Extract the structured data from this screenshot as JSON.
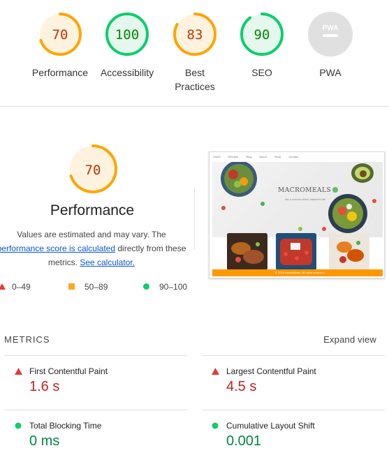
{
  "gauges": [
    {
      "label": "Performance",
      "score": "70",
      "value": 0.7,
      "status": "average"
    },
    {
      "label": "Accessibility",
      "score": "100",
      "value": 1.0,
      "status": "pass"
    },
    {
      "label_line1": "Best",
      "label_line2": "Practices",
      "score": "83",
      "value": 0.83,
      "status": "average"
    },
    {
      "label": "SEO",
      "score": "90",
      "value": 0.9,
      "status": "pass"
    },
    {
      "label": "PWA",
      "badge": "PWA",
      "status": "na"
    }
  ],
  "performance": {
    "score": "70",
    "value": 0.7,
    "title": "Performance",
    "note_before": "Values are estimated and may vary. The",
    "note_link": "performance score is calculated",
    "note_middle": "directly from these metrics.",
    "calc_link": "See calculator."
  },
  "legend": {
    "fail": "0–49",
    "average": "50–89",
    "pass": "90–100"
  },
  "thumbnail": {
    "nav": [
      "Home",
      "Recipes",
      "Blog",
      "About",
      "Shop",
      "Contact"
    ],
    "title": "MACROMEALS",
    "subtitle": "eat a macronutrient balanced life",
    "footer": "© 2023 MacroMeals. All rights reserved."
  },
  "metrics": {
    "heading": "METRICS",
    "expand_label": "Expand view",
    "items": [
      {
        "name": "First Contentful Paint",
        "value": "1.6 s",
        "status": "fail"
      },
      {
        "name": "Largest Contentful Paint",
        "value": "4.5 s",
        "status": "fail"
      },
      {
        "name": "Total Blocking Time",
        "value": "0 ms",
        "status": "pass"
      },
      {
        "name": "Cumulative Layout Shift",
        "value": "0.001",
        "status": "pass"
      }
    ]
  },
  "colors": {
    "average_stroke": "#ffa400",
    "average_fill": "#fff3e0",
    "average_text": "#c33300",
    "pass_stroke": "#0cce6b",
    "pass_fill": "#e6f8ee",
    "pass_text": "#008800",
    "fail": "#e53935",
    "na_fill": "#e0e0e0"
  }
}
